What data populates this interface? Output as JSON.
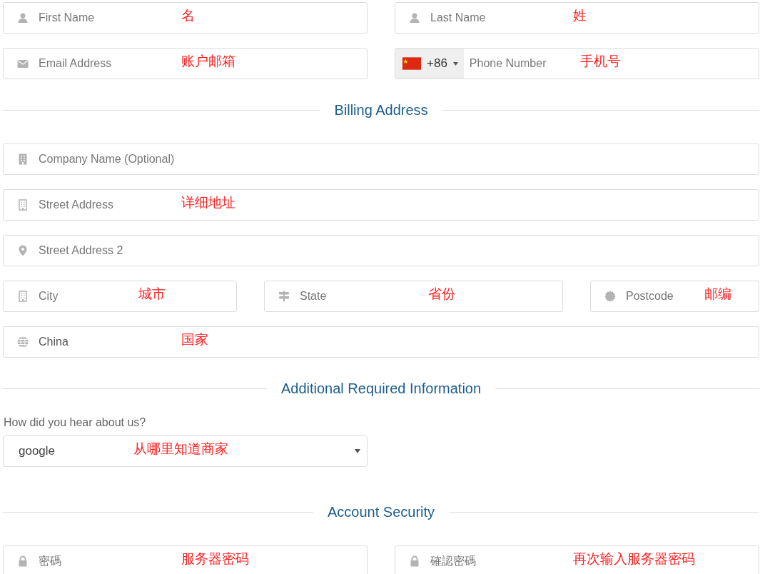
{
  "blocks": [
    {
      "kind": "fields",
      "fields": [
        {
          "kind": "name",
          "placeholder": "First Name",
          "note": "名"
        },
        {
          "kind": "name",
          "placeholder": "Last Name",
          "note": "姓"
        }
      ]
    },
    {
      "kind": "fields",
      "fields": [
        {
          "kind": "email",
          "placeholder": "Email Address",
          "note": "账户邮箱"
        },
        {
          "kind": "phone",
          "code": "+86",
          "placeholder": "Phone Number",
          "note": "手机号"
        }
      ]
    },
    {
      "kind": "heading",
      "text": "Billing Address"
    },
    {
      "kind": "fields",
      "fields": [
        {
          "kind": "company",
          "placeholder": "Company Name (Optional)"
        }
      ]
    },
    {
      "kind": "fields",
      "fields": [
        {
          "kind": "street",
          "placeholder": "Street Address",
          "note": "详细地址"
        }
      ]
    },
    {
      "kind": "fields",
      "fields": [
        {
          "kind": "street2",
          "placeholder": "Street Address 2"
        }
      ]
    },
    {
      "kind": "fields",
      "fields": [
        {
          "kind": "city",
          "placeholder": "City",
          "note": "城市"
        },
        {
          "kind": "state",
          "placeholder": "State",
          "note": "省份"
        },
        {
          "kind": "postcode",
          "placeholder": "Postcode",
          "note": "邮编"
        }
      ]
    },
    {
      "kind": "fields",
      "fields": [
        {
          "kind": "country",
          "value": "China",
          "note": "国家"
        }
      ]
    },
    {
      "kind": "heading",
      "text": "Additional Required Information"
    },
    {
      "kind": "label",
      "text": "How did you hear about us?"
    },
    {
      "kind": "select",
      "value": "google",
      "note": "从哪里知道商家"
    },
    {
      "kind": "heading",
      "text": "Account Security"
    },
    {
      "kind": "fields",
      "fields": [
        {
          "kind": "password",
          "placeholder": "密碼",
          "note": "服务器密码"
        },
        {
          "kind": "password",
          "placeholder": "確認密碼",
          "note": "再次输入服务器密码"
        }
      ]
    }
  ]
}
